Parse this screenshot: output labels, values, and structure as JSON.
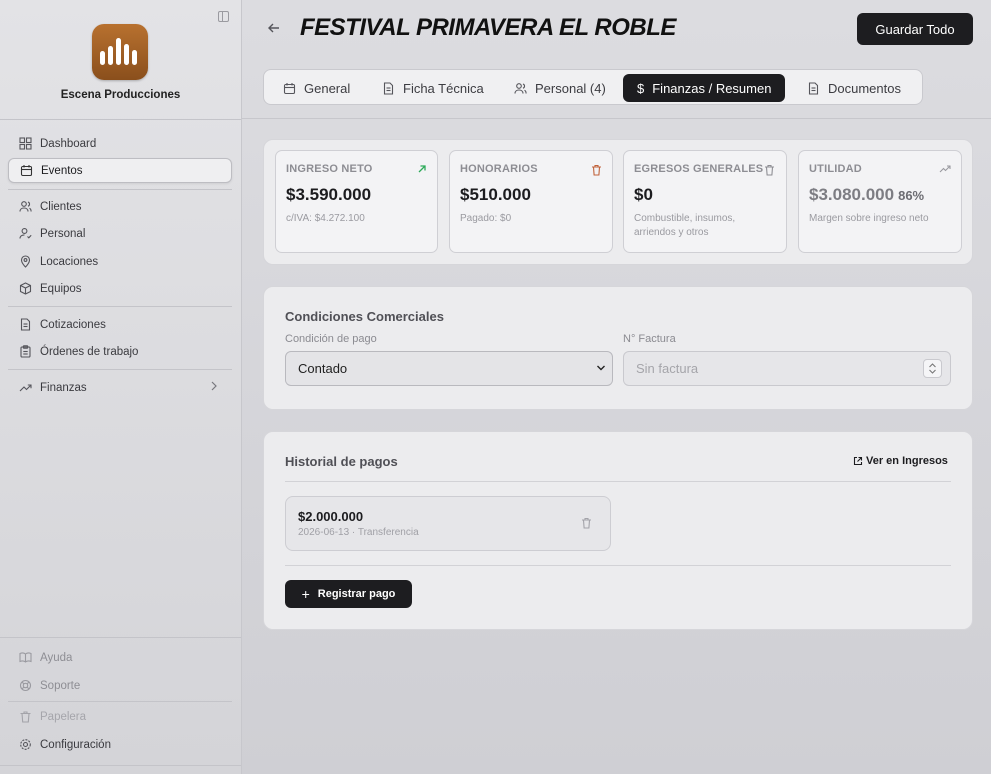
{
  "sidebar": {
    "brand": "Escena Producciones",
    "items": [
      {
        "label": "Dashboard",
        "icon": "dashboard-icon"
      },
      {
        "label": "Eventos",
        "icon": "calendar-icon",
        "active": true
      },
      {
        "label": "Clientes",
        "icon": "users-icon"
      },
      {
        "label": "Personal",
        "icon": "user-icon"
      },
      {
        "label": "Locaciones",
        "icon": "map-pin-icon"
      },
      {
        "label": "Equipos",
        "icon": "box-icon"
      },
      {
        "label": "Cotizaciones",
        "icon": "file-icon"
      },
      {
        "label": "Órdenes de trabajo",
        "icon": "clipboard-icon"
      },
      {
        "label": "Finanzas",
        "icon": "trending-icon"
      }
    ],
    "footer": [
      {
        "label": "Ayuda",
        "icon": "book-icon"
      },
      {
        "label": "Soporte",
        "icon": "lifebuoy-icon"
      },
      {
        "label": "Papelera",
        "icon": "trash-icon"
      },
      {
        "label": "Configuración",
        "icon": "gear-icon"
      }
    ]
  },
  "header": {
    "title": "FESTIVAL PRIMAVERA EL ROBLE",
    "save_label": "Guardar Todo"
  },
  "tabs": [
    {
      "label": "General",
      "icon": "calendar-icon"
    },
    {
      "label": "Ficha Técnica",
      "icon": "file-icon"
    },
    {
      "label": "Personal (4)",
      "icon": "users-icon"
    },
    {
      "label": "Finanzas / Resumen",
      "icon": "dollar-icon",
      "active": true
    },
    {
      "label": "Documentos",
      "icon": "document-icon"
    }
  ],
  "stats": [
    {
      "label": "INGRESO NETO",
      "value": "$3.590.000",
      "sub": "c/IVA: $4.272.100",
      "icon": "arrow-up-right-icon"
    },
    {
      "label": "HONORARIOS",
      "value": "$510.000",
      "sub": "Pagado: $0",
      "icon": "trash-icon"
    },
    {
      "label": "EGRESOS GENERALES",
      "value": "$0",
      "sub": "Combustible, insumos, arriendos y otros",
      "icon": "trash-icon"
    },
    {
      "label": "UTILIDAD",
      "value": "$3.080.000",
      "pct": "86%",
      "sub": "Margen sobre ingreso neto",
      "icon": "trending-up-icon"
    }
  ],
  "conditions": {
    "title": "Condiciones Comerciales",
    "payment_label": "Condición de pago",
    "payment_value": "Contado",
    "invoice_label": "N° Factura",
    "invoice_placeholder": "Sin factura"
  },
  "payments": {
    "title": "Historial de pagos",
    "link": "Ver en Ingresos",
    "items": [
      {
        "amount": "$2.000.000",
        "meta": "2026-06-13 · Transferencia"
      }
    ],
    "register_label": "Registrar pago"
  },
  "colors": {
    "accent": "#1d1d20",
    "positive": "#2eaa5a",
    "danger": "#c0623a"
  }
}
